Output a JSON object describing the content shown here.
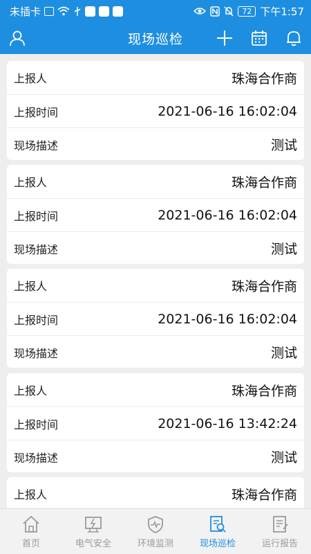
{
  "status_bar": {
    "carrier": "未插卡",
    "battery": "72",
    "time": "下午1:57"
  },
  "header": {
    "title": "现场巡检",
    "icons": [
      "user-icon",
      "plus-icon",
      "calendar-icon",
      "bell-icon"
    ]
  },
  "records": [
    {
      "reporter_label": "上报人",
      "reporter": "珠海合作商",
      "time_label": "上报时间",
      "time": "2021-06-16 16:02:04",
      "desc_label": "现场描述",
      "desc": "测试"
    },
    {
      "reporter_label": "上报人",
      "reporter": "珠海合作商",
      "time_label": "上报时间",
      "time": "2021-06-16 16:02:04",
      "desc_label": "现场描述",
      "desc": "测试"
    },
    {
      "reporter_label": "上报人",
      "reporter": "珠海合作商",
      "time_label": "上报时间",
      "time": "2021-06-16 16:02:04",
      "desc_label": "现场描述",
      "desc": "测试"
    },
    {
      "reporter_label": "上报人",
      "reporter": "珠海合作商",
      "time_label": "上报时间",
      "time": "2021-06-16 13:42:24",
      "desc_label": "现场描述",
      "desc": "测试"
    },
    {
      "reporter_label": "上报人",
      "reporter": "珠海合作商"
    }
  ],
  "tabbar": {
    "items": [
      {
        "label": "首页",
        "icon": "home-icon"
      },
      {
        "label": "电气安全",
        "icon": "electric-icon"
      },
      {
        "label": "环境监测",
        "icon": "monitor-icon"
      },
      {
        "label": "现场巡检",
        "icon": "inspect-icon",
        "active": true
      },
      {
        "label": "运行报告",
        "icon": "report-icon"
      }
    ]
  },
  "colors": {
    "primary": "#1e8fe0",
    "background": "#eeeeee",
    "tab_inactive": "#9a9a9a"
  }
}
